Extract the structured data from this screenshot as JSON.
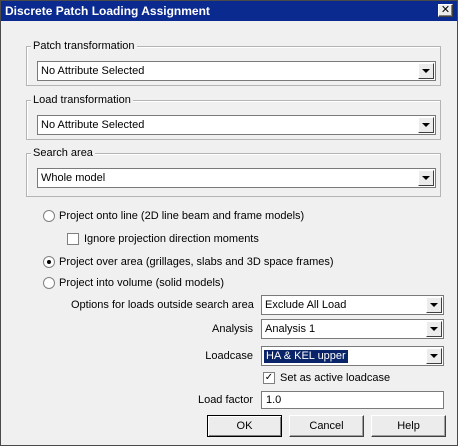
{
  "window": {
    "title": "Discrete Patch Loading Assignment",
    "close_glyph": "✕"
  },
  "patch_transformation": {
    "label": "Patch transformation",
    "value": "No Attribute Selected"
  },
  "load_transformation": {
    "label": "Load transformation",
    "value": "No Attribute Selected"
  },
  "search_area": {
    "label": "Search area",
    "value": "Whole model"
  },
  "projection": {
    "line": {
      "label": "Project onto line (2D line beam and frame models)",
      "checked": false
    },
    "ignore_moments": {
      "label": "Ignore projection direction moments",
      "checked": false
    },
    "area": {
      "label": "Project over area (grillages, slabs and 3D space frames)",
      "checked": true
    },
    "volume": {
      "label": "Project into volume (solid models)",
      "checked": false
    }
  },
  "options_outside": {
    "label": "Options for loads outside search area",
    "value": "Exclude All Load"
  },
  "analysis": {
    "label": "Analysis",
    "value": "Analysis 1"
  },
  "loadcase": {
    "label": "Loadcase",
    "value": "HA & KEL upper"
  },
  "active_loadcase": {
    "label": "Set as active loadcase",
    "check_glyph": "✓",
    "checked": true
  },
  "load_factor": {
    "label": "Load factor",
    "value": "1.0"
  },
  "buttons": {
    "ok": "OK",
    "cancel": "Cancel",
    "help": "Help"
  },
  "colors": {
    "title_bar": "#0b2a8f",
    "dialog_bg": "#f0f0f0",
    "selection": "#0a246a"
  }
}
